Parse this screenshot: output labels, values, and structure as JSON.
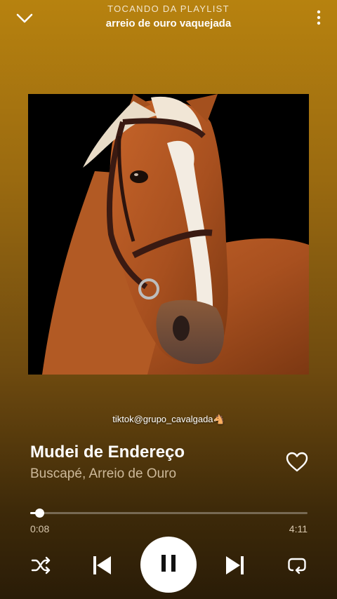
{
  "header": {
    "context_label": "TOCANDO DA PLAYLIST",
    "playlist_name": "arreio de ouro vaquejada",
    "collapse_icon": "chevron-down-icon",
    "menu_icon": "more-vertical-icon"
  },
  "artwork": {
    "subject": "chestnut horse with bridle on black background"
  },
  "watermark": "tiktok@grupo_cavalgada🐴",
  "track": {
    "title": "Mudei de Endereço",
    "artists": "Buscapé, Arreio de Ouro",
    "liked_icon": "heart-outline-icon"
  },
  "playback": {
    "current_time": "0:08",
    "total_time": "4:11",
    "progress_fraction": 0.032,
    "state_icon": "pause-icon"
  },
  "controls": {
    "shuffle_icon": "shuffle-icon",
    "previous_icon": "skip-previous-icon",
    "next_icon": "skip-next-icon",
    "repeat_icon": "repeat-icon"
  },
  "colors": {
    "gradient_top": "#b7820f",
    "gradient_bottom": "#2a1c07",
    "accent": "#ffffff"
  }
}
